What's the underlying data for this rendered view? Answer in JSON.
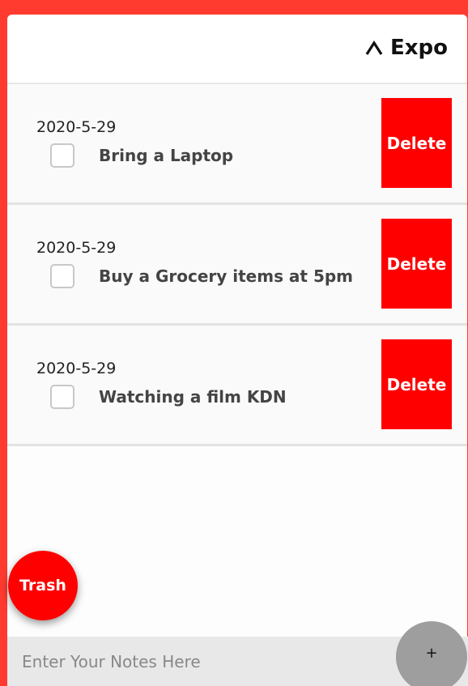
{
  "header": {
    "title": "Expo",
    "toggle_icon": "chevron-up-icon"
  },
  "notes": [
    {
      "date": "2020-5-29",
      "text": "Bring a Laptop",
      "checked": false,
      "delete_label": "Delete"
    },
    {
      "date": "2020-5-29",
      "text": "Buy a Grocery items at 5pm",
      "checked": false,
      "delete_label": "Delete"
    },
    {
      "date": "2020-5-29",
      "text": "Watching a film KDN",
      "checked": false,
      "delete_label": "Delete"
    }
  ],
  "trash": {
    "label": "Trash"
  },
  "input": {
    "placeholder": "Enter Your Notes Here",
    "value": ""
  },
  "add": {
    "label": "+"
  },
  "colors": {
    "background": "#ff3b30",
    "delete": "#ff0000",
    "trash": "#ff0000",
    "add_button": "#9e9e9e",
    "input_bar": "#e8e8e8"
  }
}
